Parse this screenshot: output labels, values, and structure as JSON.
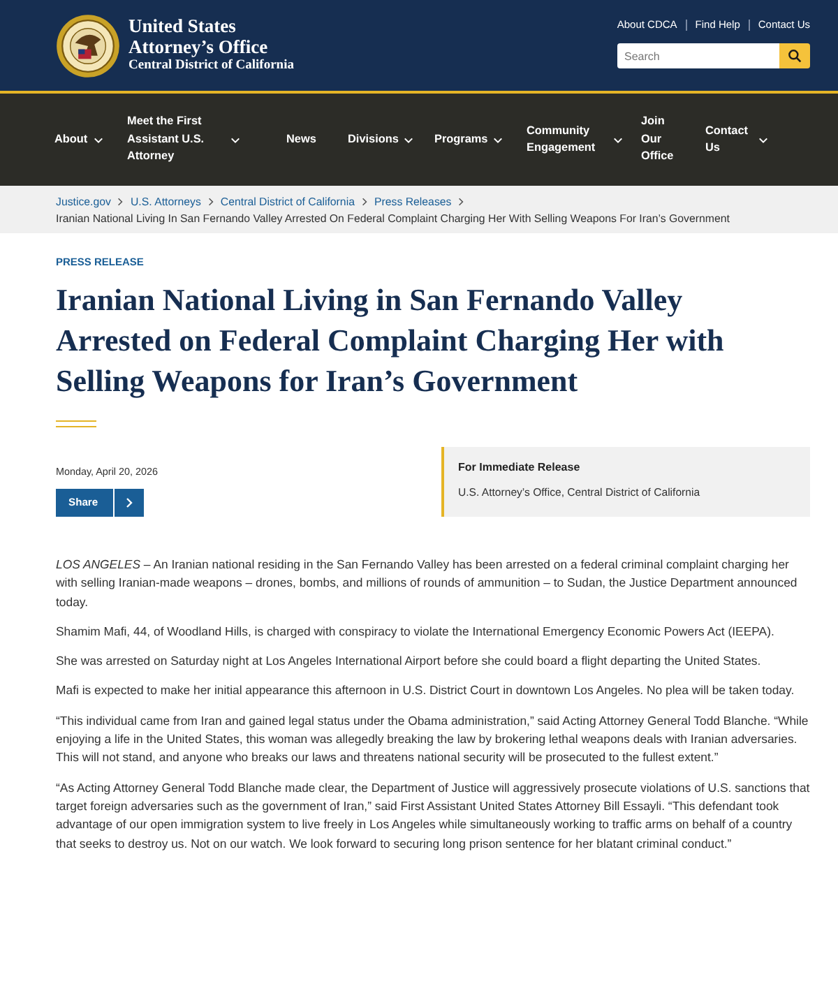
{
  "header": {
    "title_line1": "United States",
    "title_line2": "Attorney’s Office",
    "subtitle": "Central District of California",
    "utility_links": [
      "About CDCA",
      "Find Help",
      "Contact Us"
    ],
    "search": {
      "placeholder": "Search"
    }
  },
  "nav": [
    {
      "label": "About",
      "dropdown": true
    },
    {
      "label": "Meet the First Assistant U.S. Attorney",
      "dropdown": true
    },
    {
      "label": "News",
      "dropdown": false
    },
    {
      "label": "Divisions",
      "dropdown": true
    },
    {
      "label": "Programs",
      "dropdown": true
    },
    {
      "label": "Community Engagement",
      "dropdown": true
    },
    {
      "label": "Join Our Office",
      "dropdown": false
    },
    {
      "label": "Contact Us",
      "dropdown": true
    }
  ],
  "breadcrumb": {
    "links": [
      "Justice.gov",
      "U.S. Attorneys",
      "Central District of California",
      "Press Releases"
    ],
    "current": "Iranian National Living In San Fernando Valley Arrested On Federal Complaint Charging Her With Selling Weapons For Iran’s Government"
  },
  "article": {
    "eyebrow": "PRESS RELEASE",
    "title": "Iranian National Living in San Fernando Valley Arrested on Federal Complaint Charging Her with Selling Weapons for Iran’s Government",
    "date": "Monday, April 20, 2026",
    "share_label": "Share",
    "release": {
      "heading": "For Immediate Release",
      "office": "U.S. Attorney’s Office, Central District of California"
    },
    "paragraphs": [
      "*LOS ANGELES* – An Iranian national residing in the San Fernando Valley has been arrested on a federal criminal complaint charging her with selling Iranian-made weapons – drones, bombs, and millions of rounds of ammunition – to Sudan, the Justice Department announced today.",
      "Shamim Mafi, 44, of Woodland Hills, is charged with conspiracy to violate the International Emergency Economic Powers Act (IEEPA).",
      "She was arrested on Saturday night at Los Angeles International Airport before she could board a flight departing the United States.",
      "Mafi is expected to make her initial appearance this afternoon in U.S. District Court in downtown Los Angeles. No plea will be taken today.",
      "“This individual came from Iran and gained legal status under the Obama administration,” said Acting Attorney General Todd Blanche. “While enjoying a life in the United States, this woman was allegedly breaking the law by brokering lethal weapons deals with Iranian adversaries. This will not stand, and anyone who breaks our laws and threatens national security will be prosecuted to the fullest extent.”",
      "“As Acting Attorney General Todd Blanche made clear, the Department of Justice will aggressively prosecute violations of U.S. sanctions that target foreign adversaries such as the government of Iran,” said First Assistant United States Attorney Bill Essayli. “This defendant took advantage of our open immigration system to live freely in Los Angeles while simultaneously working to traffic arms on behalf of a country that seeks to destroy us. Not on our watch. We look forward to securing long prison sentence for her blatant criminal conduct.”"
    ]
  }
}
